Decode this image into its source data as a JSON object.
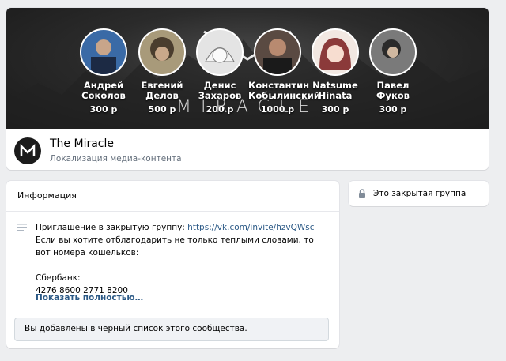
{
  "cover": {
    "logo_text": "MIRACLE",
    "donors": [
      {
        "name": "Андрей Соколов",
        "amount": "300 р",
        "bg": "#3a6aa6"
      },
      {
        "name": "Евгений Делов",
        "amount": "500 р",
        "bg": "#8a7a5a"
      },
      {
        "name": "Денис Захаров",
        "amount": "200 р",
        "bg": "#d8d8d8"
      },
      {
        "name": "Константин Кобылинский",
        "amount": "1000 р",
        "bg": "#4a3b36"
      },
      {
        "name": "Natsume Hinata",
        "amount": "300 р",
        "bg": "#e9d6cc"
      },
      {
        "name": "Павел Фуков",
        "amount": "300 р",
        "bg": "#5a5a5a"
      }
    ]
  },
  "group": {
    "name": "The Miracle",
    "status": "Локализация медиа-контента"
  },
  "info": {
    "title": "Информация",
    "desc_intro": "Приглашение в закрытую группу: ",
    "desc_link": "https://vk.com/invite/hzvQWsc",
    "desc_line2": "Если вы хотите отблагодарить не только теплыми словами, то вот номера кошельков:",
    "bank_label": "Сбербанк:",
    "bank_number": "4276 8600 2771 8200",
    "show_more": "Показать полностью…",
    "blacklist_text": "Вы добавлены в чёрный список этого сообщества."
  },
  "side": {
    "closed_group": "Это закрытая группа"
  },
  "colors": {
    "link": "#2a5885",
    "page_bg": "#edeef0"
  }
}
